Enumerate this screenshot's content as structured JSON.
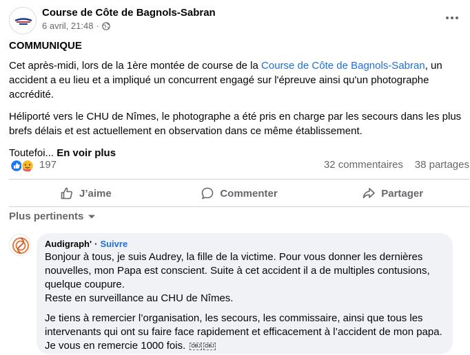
{
  "post": {
    "page_name": "Course de Côte de Bagnols-Sabran",
    "date": "6 avril, 21:48",
    "audience_icon": "globe-icon",
    "headline": "COMMUNIQUE",
    "paragraph1_before_link": "Cet après-midi, lors de la 1ère montée de course de la ",
    "paragraph1_link": "Course de Côte de Bagnols-Sabran",
    "paragraph1_after_link": ", un accident a eu lieu et a impliqué un concurrent engagé sur l'épreuve ainsi qu'un photographe accrédité.",
    "paragraph2": "Héliporté vers le CHU de Nîmes, le photographe a été pris en charge par les secours dans les plus brefs délais et est actuellement en observation dans ce même établissement.",
    "truncated_text": "Toutefoi... ",
    "see_more": "En voir plus"
  },
  "stats": {
    "reactions": [
      "like-icon",
      "care-icon"
    ],
    "reaction_count": "197",
    "comments": "32 commentaires",
    "shares": "38 partages"
  },
  "actions": {
    "like": "J’aime",
    "comment": "Commenter",
    "share": "Partager"
  },
  "comments_sort": {
    "label": "Plus pertinents"
  },
  "comment": {
    "author": "Audigraph'",
    "separator": "·",
    "follow": "Suivre",
    "line1": "Bonjour à tous, je suis Audrey, la fille de la victime. Pour vous donner les dernières nouvelles, mon Papa est conscient. Suite à cet accident il a de multiples contusions, quelque coupure.",
    "line2": "Reste en surveillance au CHU de Nîmes.",
    "paragraph2": "Je tiens à remercier l’organisation, les secours, les commissaire, ainsi que tous les intervenants qui ont su faire face rapidement et efficacement à l’accident de mon papa. Je vous en remercie 1000 fois. ",
    "obj_glyph": "OBJ",
    "obj_glyph2": "OBJ"
  },
  "colors": {
    "link": "#216fdb",
    "secondary_text": "#65676b",
    "bubble": "#f0f2f5",
    "like_blue": "#1877f2",
    "care_yellow": "#f7b928"
  }
}
